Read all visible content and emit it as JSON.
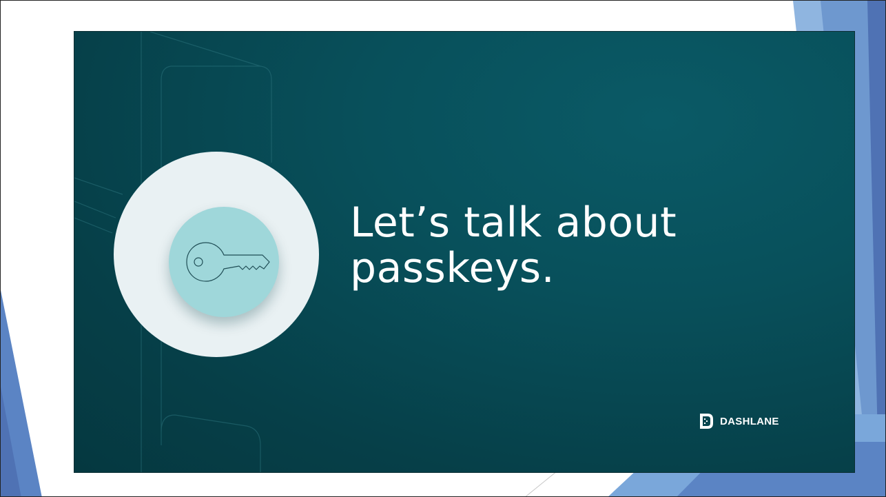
{
  "slide": {
    "background_color": "#ffffff",
    "accent_colors": [
      "#4f81bd",
      "#6fa0d3",
      "#8fb5e0"
    ]
  },
  "banner": {
    "background_color": "#064a53",
    "circle_outer_color": "#e9f1f3",
    "circle_inner_color": "#9fd7da",
    "icon": "key-icon",
    "headline_line1": "Let’s talk about",
    "headline_line2": "passkeys.",
    "brand_icon": "dashlane-logo-icon",
    "brand_name": "DASHLANE"
  }
}
